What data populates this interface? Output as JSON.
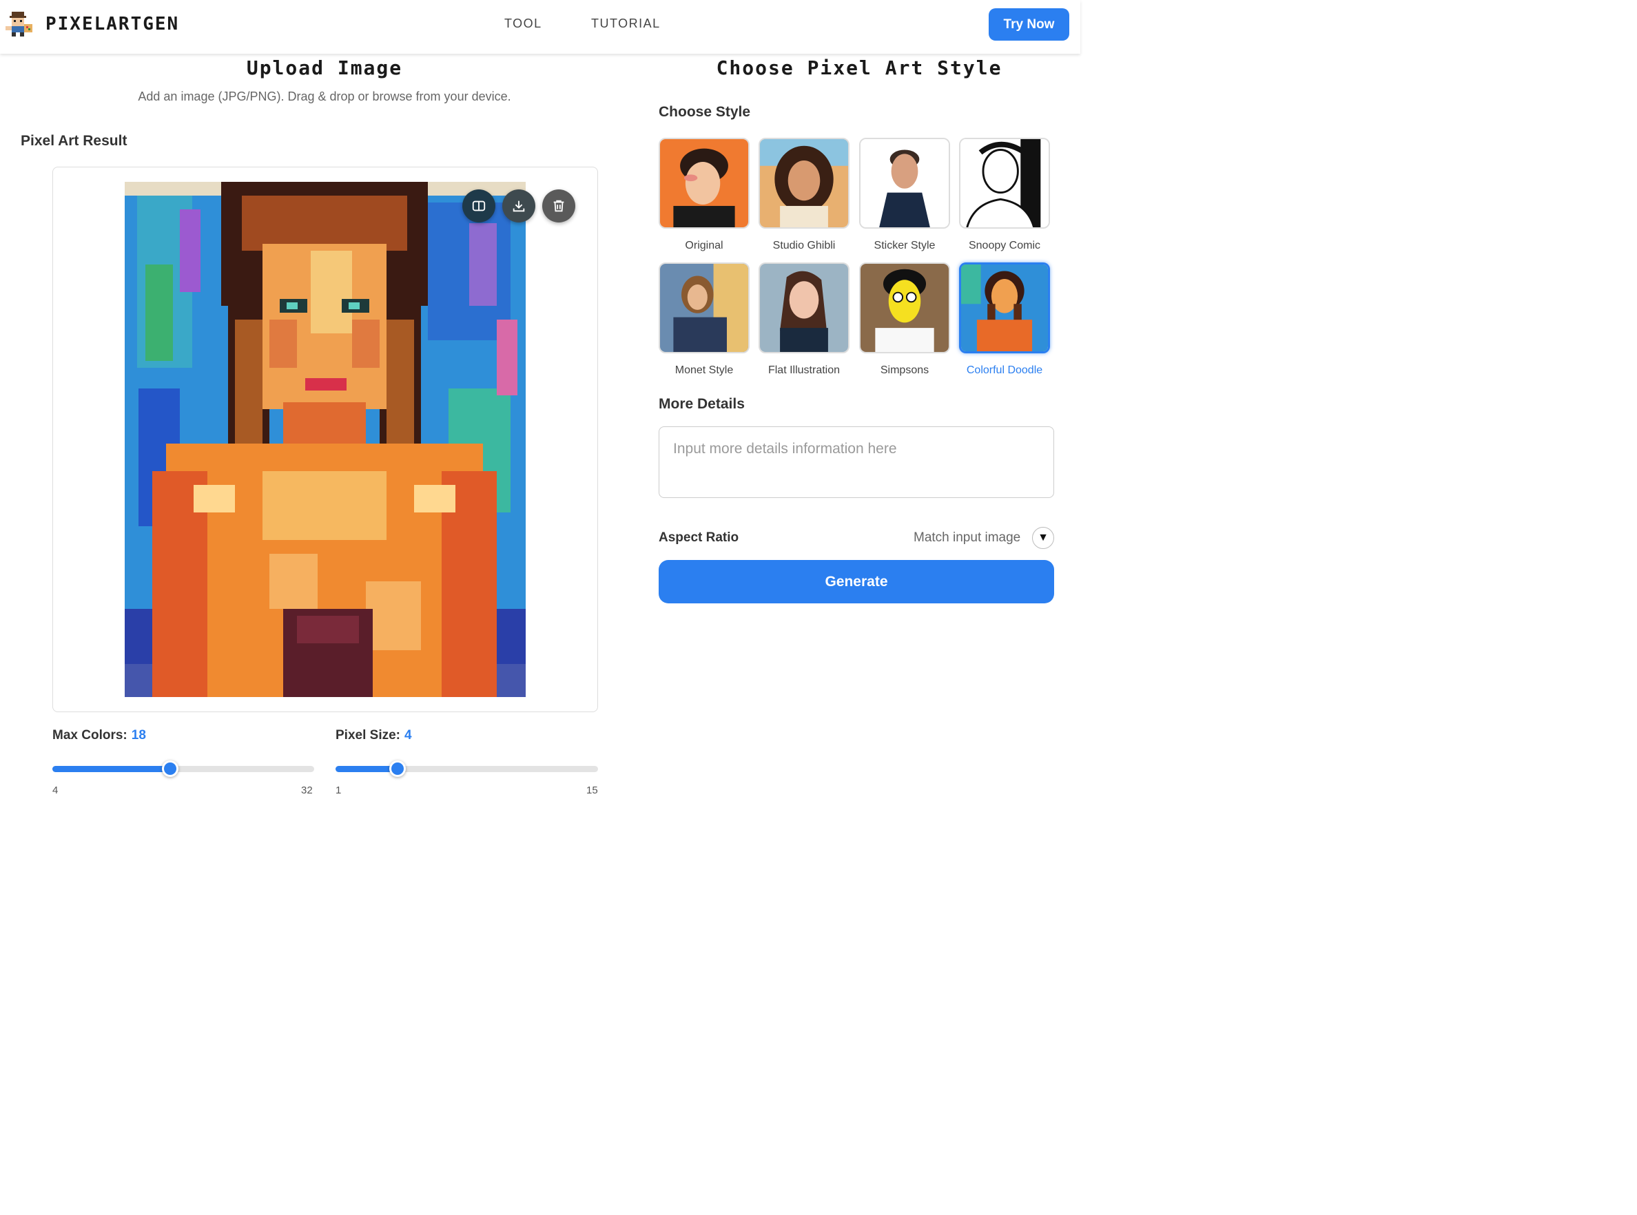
{
  "header": {
    "brand": "PIXELARTGEN",
    "nav": [
      "TOOL",
      "TUTORIAL"
    ],
    "cta": "Try Now"
  },
  "upload": {
    "title": "Upload Image",
    "subtitle": "Add an image (JPG/PNG). Drag & drop or browse from your device."
  },
  "result": {
    "label": "Pixel Art Result",
    "actions": [
      "compare-icon",
      "download-icon",
      "trash-icon"
    ]
  },
  "sliders": {
    "max_colors": {
      "label": "Max Colors:",
      "value": "18",
      "min": "4",
      "max": "32",
      "fraction": 0.45
    },
    "pixel_size": {
      "label": "Pixel Size:",
      "value": "4",
      "min": "1",
      "max": "15",
      "fraction": 0.236
    }
  },
  "styles": {
    "title": "Choose Pixel Art Style",
    "label": "Choose Style",
    "items": [
      {
        "name": "Original",
        "selected": false
      },
      {
        "name": "Studio Ghibli",
        "selected": false
      },
      {
        "name": "Sticker Style",
        "selected": false
      },
      {
        "name": "Snoopy Comic",
        "selected": false
      },
      {
        "name": "Monet Style",
        "selected": false
      },
      {
        "name": "Flat Illustration",
        "selected": false
      },
      {
        "name": "Simpsons",
        "selected": false
      },
      {
        "name": "Colorful Doodle",
        "selected": true
      }
    ]
  },
  "details": {
    "label": "More Details",
    "placeholder": "Input more details information here"
  },
  "aspect": {
    "label": "Aspect Ratio",
    "value": "Match input image"
  },
  "generate_label": "Generate",
  "colors": {
    "accent": "#2b7ff0"
  }
}
